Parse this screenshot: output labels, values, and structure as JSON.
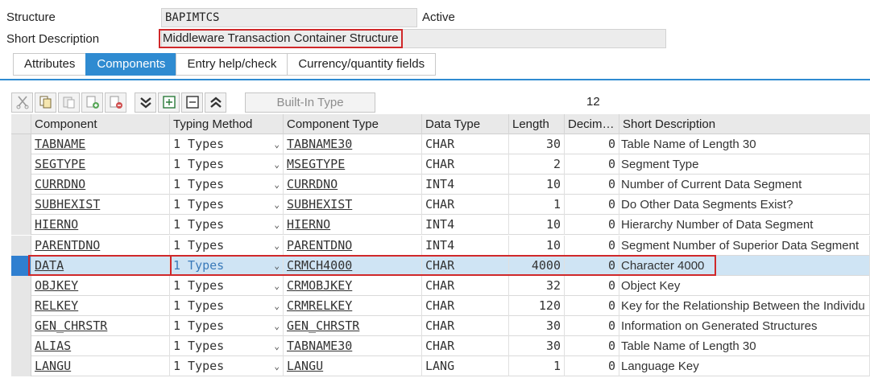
{
  "header": {
    "structure_label": "Structure",
    "structure_value": "BAPIMTCS",
    "status": "Active",
    "short_desc_label": "Short Description",
    "short_desc_value": "Middleware Transaction Container Structure"
  },
  "tabs": [
    {
      "label": "Attributes",
      "active": false
    },
    {
      "label": "Components",
      "active": true
    },
    {
      "label": "Entry help/check",
      "active": false
    },
    {
      "label": "Currency/quantity fields",
      "active": false
    }
  ],
  "toolbar": {
    "icons": [
      "cut-icon",
      "copy-icon",
      "paste-icon",
      "insert-row-icon",
      "delete-row-icon",
      "collapse-icon",
      "expand-first-icon",
      "collapse-first-icon",
      "expand-all-icon"
    ],
    "builtin_label": "Built-In Type",
    "count": "12"
  },
  "columns": [
    "Component",
    "Typing Method",
    "Component Type",
    "Data Type",
    "Length",
    "Decim…",
    "Short Description"
  ],
  "rows": [
    {
      "component": "TABNAME",
      "typing": "1 Types",
      "ctype": "TABNAME30",
      "dtype": "CHAR",
      "length": "30",
      "dec": "0",
      "desc": "Table Name of Length 30"
    },
    {
      "component": "SEGTYPE",
      "typing": "1 Types",
      "ctype": "MSEGTYPE",
      "dtype": "CHAR",
      "length": "2",
      "dec": "0",
      "desc": "Segment Type"
    },
    {
      "component": "CURRDNO",
      "typing": "1 Types",
      "ctype": "CURRDNO",
      "dtype": "INT4",
      "length": "10",
      "dec": "0",
      "desc": "Number of Current Data Segment"
    },
    {
      "component": "SUBHEXIST",
      "typing": "1 Types",
      "ctype": "SUBHEXIST",
      "dtype": "CHAR",
      "length": "1",
      "dec": "0",
      "desc": "Do Other Data Segments Exist?"
    },
    {
      "component": "HIERNO",
      "typing": "1 Types",
      "ctype": "HIERNO",
      "dtype": "INT4",
      "length": "10",
      "dec": "0",
      "desc": "Hierarchy Number of Data Segment"
    },
    {
      "component": "PARENTDNO",
      "typing": "1 Types",
      "ctype": "PARENTDNO",
      "dtype": "INT4",
      "length": "10",
      "dec": "0",
      "desc": "Segment Number of Superior Data Segment"
    },
    {
      "component": "DATA",
      "typing": "1 Types",
      "ctype": "CRMCH4000",
      "dtype": "CHAR",
      "length": "4000",
      "dec": "0",
      "desc": "Character 4000",
      "selected": true
    },
    {
      "component": "OBJKEY",
      "typing": "1 Types",
      "ctype": "CRMOBJKEY",
      "dtype": "CHAR",
      "length": "32",
      "dec": "0",
      "desc": "Object Key"
    },
    {
      "component": "RELKEY",
      "typing": "1 Types",
      "ctype": "CRMRELKEY",
      "dtype": "CHAR",
      "length": "120",
      "dec": "0",
      "desc": "Key for the Relationship Between the Individu"
    },
    {
      "component": "GEN_CHRSTR",
      "typing": "1 Types",
      "ctype": "GEN_CHRSTR",
      "dtype": "CHAR",
      "length": "30",
      "dec": "0",
      "desc": "Information on Generated Structures"
    },
    {
      "component": "ALIAS",
      "typing": "1 Types",
      "ctype": "TABNAME30",
      "dtype": "CHAR",
      "length": "30",
      "dec": "0",
      "desc": "Table Name of Length 30"
    },
    {
      "component": "LANGU",
      "typing": "1 Types",
      "ctype": "LANGU",
      "dtype": "LANG",
      "length": "1",
      "dec": "0",
      "desc": "Language Key"
    }
  ],
  "colors": {
    "accent": "#2f8bd1",
    "highlight_border": "#d0282a",
    "selected_row": "#cfe4f4"
  }
}
